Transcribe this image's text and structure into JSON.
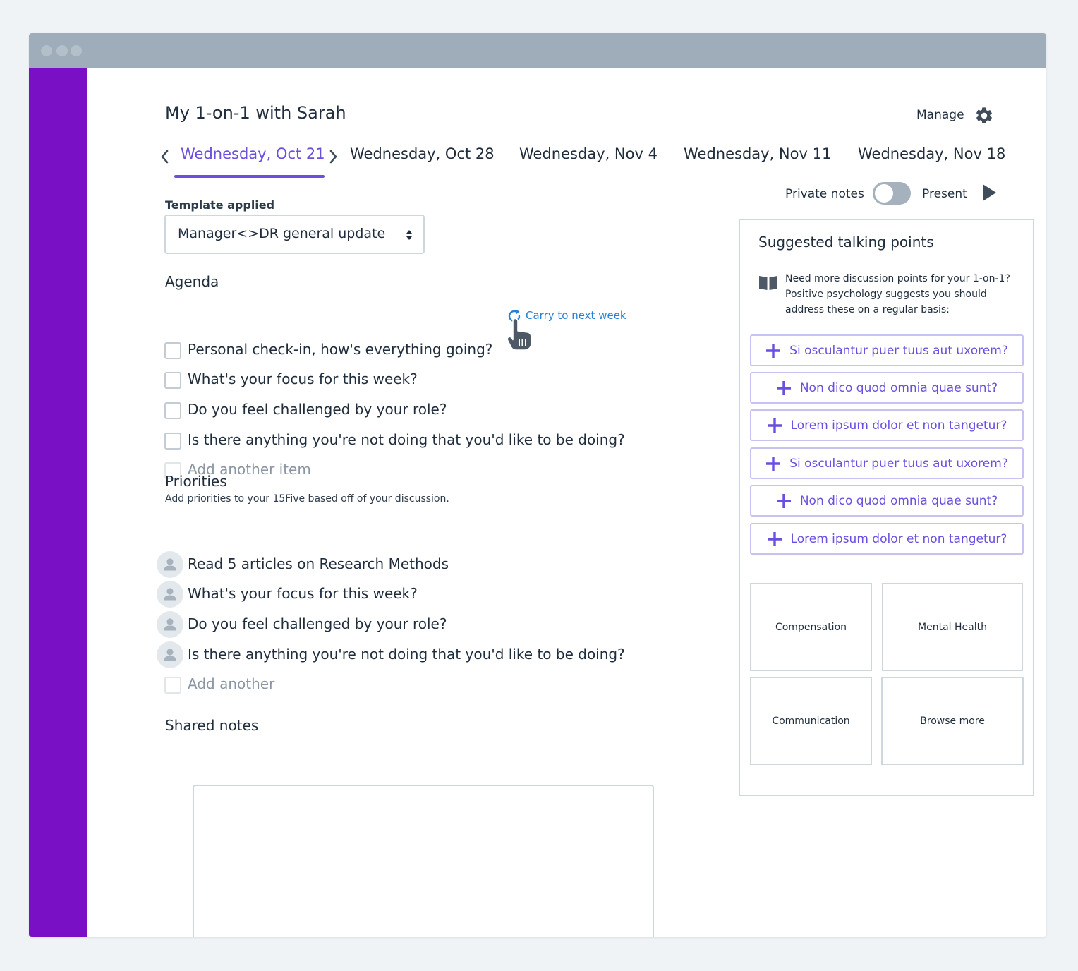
{
  "header": {
    "title": "My 1-on-1 with Sarah",
    "manage_label": "Manage"
  },
  "dates": {
    "tabs": [
      "Wednesday, Oct 21",
      "Wednesday, Oct 28",
      "Wednesday, Nov 4",
      "Wednesday, Nov 11",
      "Wednesday, Nov 18"
    ],
    "active_index": 0
  },
  "toolbar": {
    "private_notes_label": "Private notes",
    "private_notes_on": false,
    "present_label": "Present"
  },
  "template": {
    "label": "Template applied",
    "value": "Manager<>DR general update"
  },
  "agenda": {
    "title": "Agenda",
    "items": [
      "Personal check-in, how's everything going?",
      "What's your focus for this week?",
      "Do you feel challenged by your role?",
      "Is there anything you're not doing that you'd like to be doing?"
    ],
    "add_label": "Add another item",
    "carry_label": "Carry to next week"
  },
  "priorities": {
    "title": "Priorities",
    "subtitle": "Add priorities to your 15Five based off of your discussion.",
    "items": [
      "Read 5 articles on Research Methods",
      "What's your focus for this week?",
      "Do you feel challenged by your role?",
      "Is there anything you're not doing that you'd like to be doing?"
    ],
    "add_label": "Add another"
  },
  "shared_notes": {
    "title": "Shared notes"
  },
  "suggestions": {
    "title": "Suggested talking points",
    "description": "Need more discussion points for your 1-on-1? Positive psychology suggests you should address these on a regular basis:",
    "items": [
      "Si osculantur puer tuus aut uxorem?",
      "Non dico quod omnia quae sunt?",
      "Lorem ipsum dolor et non tangetur?",
      "Si osculantur puer tuus aut uxorem?",
      "Non dico quod omnia quae sunt?",
      "Lorem ipsum dolor et non tangetur?"
    ],
    "categories": [
      "Compensation",
      "Mental Health",
      "Communication",
      "Browse more"
    ]
  },
  "colors": {
    "sidebar": "#7a10c6",
    "accent": "#6a4fe0",
    "link": "#2a7fd4",
    "titlebar": "#9eadb9"
  }
}
